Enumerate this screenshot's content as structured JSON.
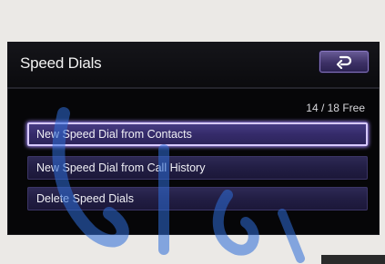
{
  "screen": {
    "title": "Speed Dials",
    "free_count": "14 / 18 Free",
    "back_icon": "back-arrow-icon"
  },
  "menu": {
    "items": [
      {
        "label": "New Speed Dial from Contacts",
        "selected": true
      },
      {
        "label": "New Speed Dial from Call History",
        "selected": false
      },
      {
        "label": "Delete Speed Dials",
        "selected": false
      }
    ]
  },
  "colors": {
    "background": "#060608",
    "button_accent": "#3d3166",
    "selected_outline": "#d7c9ff"
  }
}
